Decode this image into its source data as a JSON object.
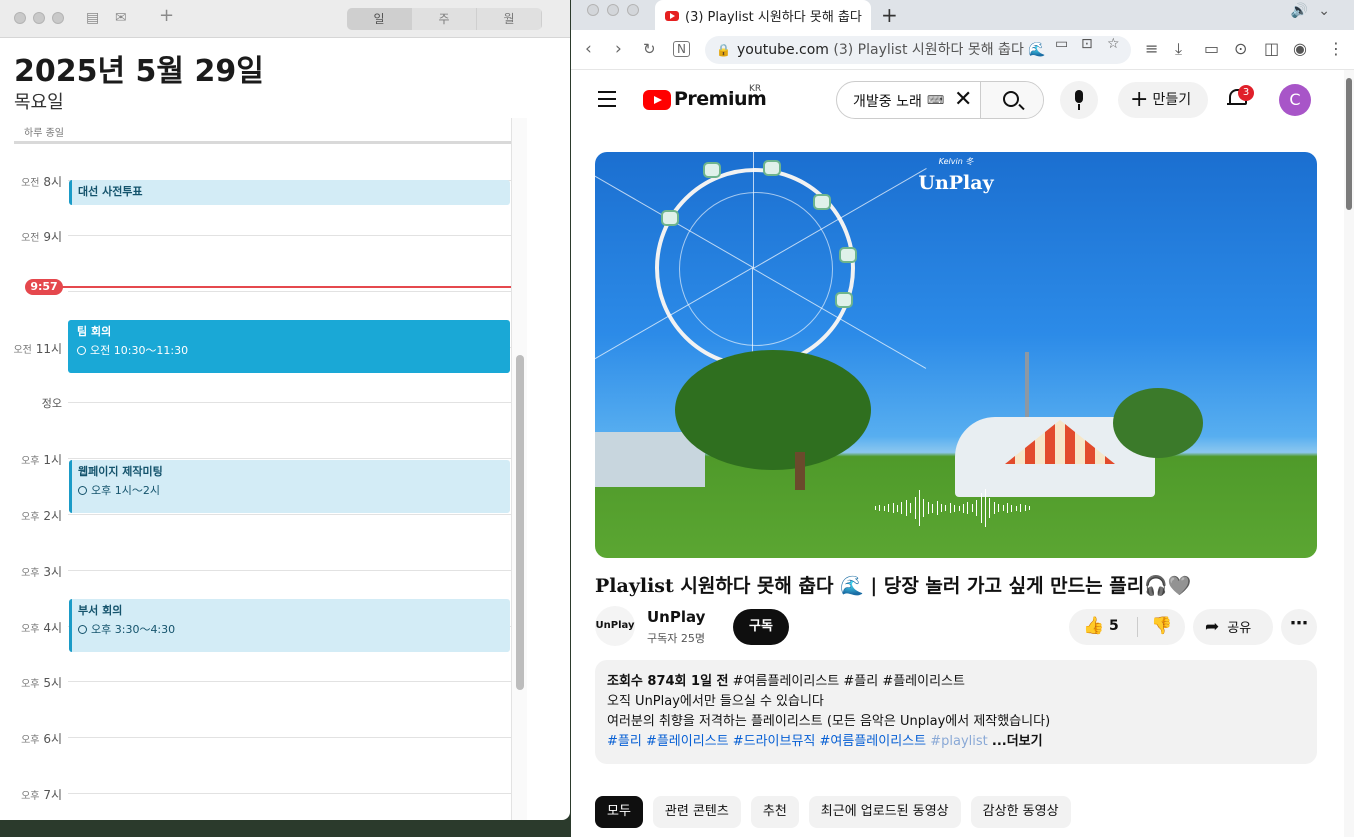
{
  "calendar": {
    "view_tabs": [
      "일",
      "주",
      "월"
    ],
    "date_title": "2025년 5월 29일",
    "weekday": "목요일",
    "all_day_label": "하루 종일",
    "hours": [
      {
        "ap": "오전",
        "h": "8시"
      },
      {
        "ap": "오전",
        "h": "9시"
      },
      {
        "ap": "오전",
        "h": "11시"
      },
      {
        "ap": "",
        "h": "정오"
      },
      {
        "ap": "오후",
        "h": "1시"
      },
      {
        "ap": "오후",
        "h": "2시"
      },
      {
        "ap": "오후",
        "h": "3시"
      },
      {
        "ap": "오후",
        "h": "4시"
      },
      {
        "ap": "오후",
        "h": "5시"
      },
      {
        "ap": "오후",
        "h": "6시"
      },
      {
        "ap": "오후",
        "h": "7시"
      }
    ],
    "current_time": "9:57",
    "events": [
      {
        "title": "대선 사전투표",
        "time": ""
      },
      {
        "title": "팀 회의",
        "time": "오전 10:30～11:30"
      },
      {
        "title": "웹페이지 제작미팅",
        "time": "오후 1시～2시"
      },
      {
        "title": "부서 회의",
        "time": "오후 3:30～4:30"
      }
    ],
    "colors": {
      "event_light": "#d3ecf6",
      "event_strong": "#1aa8d6",
      "now": "#e5484d"
    }
  },
  "browser": {
    "tab_title": "(3) Playlist 시원하다 못해 춥다",
    "url_host": "youtube.com",
    "url_page_title": "(3) Playlist 시원하다 못해 춥다 🌊"
  },
  "youtube": {
    "logo_text": "Premium",
    "region": "KR",
    "search_query": "개발중 노래",
    "keyboard_icon": "⌨",
    "create_label": "만들기",
    "notification_count": "3",
    "avatar_letter": "C",
    "video": {
      "brand_small": "Kelvin 冬",
      "brand": "UnPlay",
      "title": "Playlist 시원하다 못해 춥다 🌊 | 당장 놀러 가고 싶게 만드는 플리🎧🩶",
      "channel_logo": "UnPlay",
      "channel_name": "UnPlay",
      "subscribers": "구독자 25명",
      "subscribe_label": "구독",
      "likes": "5",
      "share_label": "공유"
    },
    "description": {
      "meta": "조회수 874회  1일 전",
      "meta_tags": "#여름플레이리스트 #플리 #플레이리스트",
      "line1": "오직 UnPlay에서만 들으실 수 있습니다",
      "line2": "여러분의 취향을 저격하는 플레이리스트 (모든 음악은 Unplay에서 제작했습니다)",
      "tags": "#플리 #플레이리스트 #드라이브뮤직 #여름플레이리스트",
      "tag_fade": "#playlist",
      "more": "...더보기"
    },
    "chips": [
      "모두",
      "관련 콘텐츠",
      "추천",
      "최근에 업로드된 동영상",
      "감상한 동영상"
    ]
  }
}
